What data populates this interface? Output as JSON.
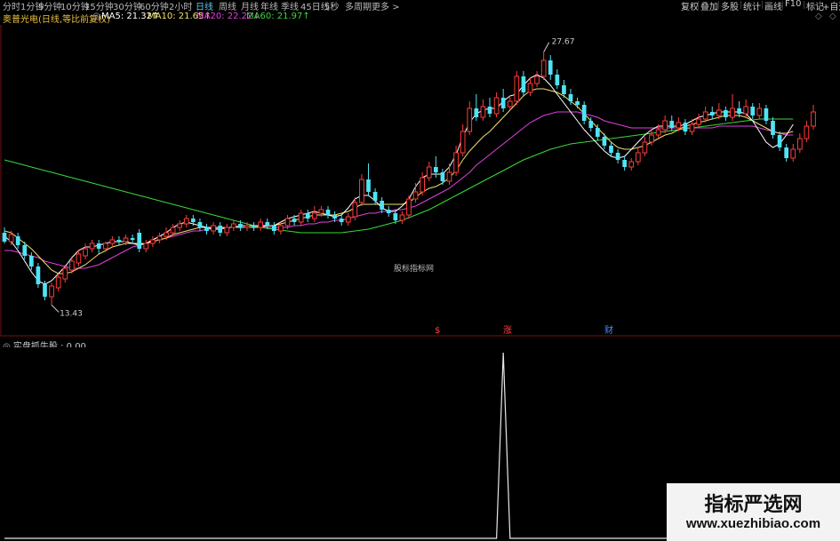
{
  "toolbar": {
    "periods": [
      "分时",
      "1分钟",
      "5分钟",
      "10分钟",
      "15分钟",
      "30分钟",
      "60分钟",
      "2小时",
      "日线",
      "周线",
      "月线",
      "年线",
      "季线",
      "45日线",
      "5秒",
      "多周期",
      "更多 >"
    ],
    "active_period": "日线",
    "right_buttons": [
      "复权",
      "叠加",
      "多股",
      "统计",
      "画线",
      "F10",
      "标记",
      "+自选"
    ]
  },
  "stock": {
    "title": "奥普光电(日线,等比前复权)",
    "ma": [
      {
        "label": "MA5: 21.32↑",
        "color": "#ffffff"
      },
      {
        "label": "MA10: 21.65↑",
        "color": "#f2e06a"
      },
      {
        "label": "MA20: 22.22↓",
        "color": "#e040e0"
      },
      {
        "label": "MA60: 21.97↑",
        "color": "#3ad83a"
      }
    ]
  },
  "chart_data": {
    "type": "candlestick",
    "high_label": "27.67",
    "low_label": "13.43",
    "center_label": "股标指标网",
    "event_markers": [
      {
        "text": "$",
        "color": "#ff4040"
      },
      {
        "text": "涨",
        "color": "#ff4040"
      },
      {
        "text": "财",
        "color": "#4a8cff"
      }
    ],
    "price_range": [
      12.5,
      28.5
    ],
    "candles": [
      [
        17.5,
        17.0,
        17.8,
        16.9
      ],
      [
        17.0,
        17.4,
        17.6,
        16.8
      ],
      [
        17.3,
        16.8,
        17.5,
        16.6
      ],
      [
        16.8,
        16.2,
        17.0,
        16.0
      ],
      [
        16.2,
        15.6,
        16.4,
        15.4
      ],
      [
        15.6,
        14.6,
        15.8,
        14.4
      ],
      [
        14.6,
        13.9,
        14.8,
        13.7
      ],
      [
        13.9,
        14.5,
        14.7,
        13.43
      ],
      [
        14.4,
        15.0,
        15.2,
        14.2
      ],
      [
        14.9,
        15.5,
        15.7,
        14.7
      ],
      [
        15.4,
        15.9,
        16.1,
        15.2
      ],
      [
        15.8,
        16.3,
        16.5,
        15.6
      ],
      [
        16.2,
        16.6,
        16.9,
        16.0
      ],
      [
        16.6,
        16.9,
        17.1,
        16.4
      ],
      [
        16.9,
        16.6,
        17.1,
        16.3
      ],
      [
        16.6,
        16.9,
        17.0,
        16.4
      ],
      [
        16.9,
        17.1,
        17.3,
        16.7
      ],
      [
        17.1,
        17.0,
        17.3,
        16.8
      ],
      [
        17.0,
        17.2,
        17.4,
        16.8
      ],
      [
        17.2,
        17.1,
        17.4,
        16.9
      ],
      [
        17.5,
        16.6,
        17.7,
        16.4
      ],
      [
        16.6,
        16.9,
        17.1,
        16.4
      ],
      [
        16.9,
        17.1,
        17.3,
        16.7
      ],
      [
        17.1,
        17.3,
        17.5,
        16.9
      ],
      [
        17.3,
        17.5,
        17.8,
        17.1
      ],
      [
        17.5,
        17.8,
        18.0,
        17.3
      ],
      [
        17.8,
        18.0,
        18.2,
        17.6
      ],
      [
        18.0,
        18.3,
        18.5,
        17.8
      ],
      [
        18.3,
        18.1,
        18.5,
        17.9
      ],
      [
        18.1,
        17.8,
        18.3,
        17.6
      ],
      [
        17.8,
        17.6,
        18.0,
        17.4
      ],
      [
        17.6,
        17.9,
        18.1,
        17.4
      ],
      [
        17.9,
        17.5,
        18.1,
        17.3
      ],
      [
        17.5,
        17.8,
        18.0,
        17.3
      ],
      [
        17.8,
        18.0,
        18.2,
        17.6
      ],
      [
        18.0,
        17.8,
        18.2,
        17.6
      ],
      [
        17.8,
        17.9,
        18.1,
        17.6
      ],
      [
        17.9,
        17.8,
        18.1,
        17.6
      ],
      [
        17.8,
        18.1,
        18.3,
        17.6
      ],
      [
        18.1,
        17.9,
        18.3,
        17.7
      ],
      [
        17.9,
        17.6,
        18.1,
        17.4
      ],
      [
        17.6,
        17.9,
        18.1,
        17.4
      ],
      [
        17.9,
        18.3,
        18.5,
        17.7
      ],
      [
        18.3,
        18.1,
        18.5,
        17.9
      ],
      [
        18.1,
        18.6,
        18.8,
        17.9
      ],
      [
        18.6,
        18.3,
        18.8,
        18.1
      ],
      [
        18.3,
        18.6,
        19.0,
        18.1
      ],
      [
        18.6,
        18.8,
        19.0,
        18.4
      ],
      [
        18.8,
        18.5,
        19.0,
        18.3
      ],
      [
        18.5,
        18.3,
        18.7,
        18.1
      ],
      [
        18.3,
        18.1,
        18.5,
        17.9
      ],
      [
        18.1,
        18.4,
        18.6,
        17.9
      ],
      [
        18.4,
        19.2,
        19.5,
        18.2
      ],
      [
        19.2,
        20.5,
        20.8,
        19.0
      ],
      [
        20.5,
        19.8,
        21.4,
        19.6
      ],
      [
        19.8,
        19.3,
        20.0,
        19.1
      ],
      [
        19.3,
        18.8,
        19.5,
        18.6
      ],
      [
        18.8,
        18.6,
        19.0,
        18.4
      ],
      [
        18.6,
        18.2,
        18.8,
        18.0
      ],
      [
        18.2,
        18.5,
        18.7,
        18.0
      ],
      [
        18.5,
        19.4,
        19.6,
        18.3
      ],
      [
        19.4,
        19.8,
        20.3,
        19.2
      ],
      [
        19.8,
        20.6,
        20.9,
        19.6
      ],
      [
        20.6,
        21.2,
        21.5,
        20.4
      ],
      [
        21.2,
        20.9,
        21.8,
        20.6
      ],
      [
        20.9,
        20.4,
        21.1,
        20.2
      ],
      [
        20.4,
        20.9,
        21.4,
        20.2
      ],
      [
        20.9,
        22.0,
        22.4,
        20.7
      ],
      [
        22.0,
        23.2,
        23.6,
        21.8
      ],
      [
        23.2,
        24.5,
        24.9,
        23.0
      ],
      [
        24.5,
        24.0,
        25.3,
        23.8
      ],
      [
        24.0,
        24.6,
        25.0,
        23.8
      ],
      [
        24.6,
        24.2,
        25.1,
        24.0
      ],
      [
        24.2,
        25.1,
        25.4,
        24.0
      ],
      [
        25.1,
        24.5,
        25.6,
        24.3
      ],
      [
        24.6,
        24.9,
        25.2,
        24.4
      ],
      [
        24.9,
        26.3,
        26.6,
        24.7
      ],
      [
        26.3,
        25.4,
        26.6,
        25.2
      ],
      [
        25.4,
        25.9,
        26.2,
        25.2
      ],
      [
        25.9,
        26.3,
        26.6,
        25.7
      ],
      [
        26.3,
        27.2,
        27.67,
        26.1
      ],
      [
        27.2,
        26.4,
        27.5,
        26.1
      ],
      [
        26.4,
        25.8,
        26.7,
        25.6
      ],
      [
        25.8,
        25.3,
        26.1,
        25.1
      ],
      [
        25.3,
        24.9,
        25.6,
        24.7
      ],
      [
        24.9,
        24.7,
        25.1,
        24.5
      ],
      [
        24.7,
        23.8,
        24.9,
        23.6
      ],
      [
        23.8,
        23.4,
        24.0,
        23.2
      ],
      [
        23.4,
        22.9,
        23.6,
        22.7
      ],
      [
        22.9,
        22.4,
        23.1,
        22.2
      ],
      [
        22.4,
        22.0,
        22.6,
        21.8
      ],
      [
        22.0,
        21.6,
        22.2,
        21.4
      ],
      [
        21.6,
        21.2,
        21.8,
        21.0
      ],
      [
        21.2,
        21.5,
        21.7,
        21.0
      ],
      [
        21.5,
        22.0,
        22.3,
        21.3
      ],
      [
        22.0,
        22.6,
        22.9,
        21.8
      ],
      [
        22.6,
        23.0,
        23.3,
        22.4
      ],
      [
        23.0,
        23.3,
        23.6,
        22.8
      ],
      [
        23.3,
        23.8,
        24.1,
        23.1
      ],
      [
        23.8,
        23.4,
        24.1,
        23.2
      ],
      [
        23.4,
        23.7,
        24.0,
        23.2
      ],
      [
        23.7,
        23.2,
        23.9,
        23.0
      ],
      [
        23.2,
        23.6,
        23.9,
        23.0
      ],
      [
        23.6,
        23.9,
        24.2,
        23.4
      ],
      [
        23.9,
        24.3,
        24.6,
        23.7
      ],
      [
        24.3,
        24.1,
        24.6,
        23.9
      ],
      [
        24.1,
        24.4,
        24.8,
        23.9
      ],
      [
        24.4,
        24.0,
        24.6,
        23.8
      ],
      [
        24.0,
        24.5,
        25.3,
        23.8
      ],
      [
        24.5,
        24.2,
        24.9,
        24.0
      ],
      [
        24.2,
        24.6,
        25.0,
        24.0
      ],
      [
        24.6,
        24.1,
        24.8,
        23.9
      ],
      [
        24.1,
        24.5,
        24.8,
        23.9
      ],
      [
        24.5,
        23.8,
        24.7,
        23.6
      ],
      [
        23.8,
        23.0,
        24.0,
        22.8
      ],
      [
        23.0,
        22.3,
        23.2,
        22.1
      ],
      [
        22.3,
        21.7,
        22.5,
        21.5
      ],
      [
        21.7,
        22.2,
        22.5,
        21.5
      ],
      [
        22.2,
        22.8,
        23.1,
        22.0
      ],
      [
        22.8,
        23.5,
        23.8,
        22.6
      ],
      [
        23.5,
        24.3,
        24.7,
        23.3
      ]
    ],
    "ma5": [
      17.3,
      17.0,
      16.5,
      15.9,
      15.3,
      14.8,
      14.6,
      14.8,
      15.2,
      15.6,
      16.1,
      16.5,
      16.7,
      16.7,
      16.8,
      16.9,
      17.0,
      17.0,
      17.0,
      16.9,
      16.8,
      16.9,
      17.1,
      17.3,
      17.5,
      17.8,
      18.0,
      18.1,
      18.0,
      17.9,
      17.8,
      17.7,
      17.7,
      17.8,
      17.8,
      17.9,
      17.9,
      17.9,
      17.9,
      17.9,
      17.9,
      18.1,
      18.3,
      18.4,
      18.5,
      18.6,
      18.7,
      18.6,
      18.5,
      18.4,
      18.5,
      18.9,
      19.4,
      19.6,
      19.6,
      19.3,
      18.9,
      18.7,
      18.7,
      19.0,
      19.4,
      20.1,
      20.6,
      20.8,
      20.8,
      20.8,
      21.2,
      21.9,
      22.9,
      23.7,
      24.2,
      24.4,
      24.5,
      24.5,
      24.9,
      25.2,
      25.3,
      25.8,
      26.2,
      26.4,
      26.2,
      25.8,
      25.3,
      24.8,
      24.3,
      23.8,
      23.3,
      22.9,
      22.5,
      22.1,
      21.8,
      21.7,
      21.8,
      22.2,
      22.6,
      23.0,
      23.3,
      23.5,
      23.5,
      23.5,
      23.5,
      23.6,
      23.8,
      24.0,
      24.1,
      24.2,
      24.3,
      24.3,
      24.3,
      24.3,
      24.2,
      23.8,
      23.2,
      22.6,
      22.3,
      22.5,
      23.0,
      23.6
    ],
    "ma10": [
      17.6,
      17.5,
      17.2,
      16.9,
      16.6,
      16.2,
      15.8,
      15.4,
      15.2,
      15.2,
      15.3,
      15.5,
      15.7,
      16.0,
      16.3,
      16.5,
      16.7,
      16.8,
      16.9,
      16.9,
      16.9,
      16.9,
      17.0,
      17.1,
      17.2,
      17.4,
      17.5,
      17.6,
      17.7,
      17.8,
      17.8,
      17.8,
      17.8,
      17.8,
      17.8,
      17.8,
      17.8,
      17.8,
      17.8,
      17.9,
      17.9,
      18.0,
      18.1,
      18.2,
      18.3,
      18.4,
      18.5,
      18.5,
      18.5,
      18.5,
      18.6,
      18.7,
      18.9,
      19.1,
      19.1,
      19.1,
      19.1,
      19.1,
      19.1,
      19.1,
      19.2,
      19.5,
      19.8,
      20.0,
      20.1,
      20.3,
      20.6,
      21.0,
      21.6,
      22.1,
      22.5,
      22.9,
      23.2,
      23.6,
      24.0,
      24.4,
      24.8,
      25.2,
      25.5,
      25.6,
      25.6,
      25.5,
      25.4,
      25.2,
      24.9,
      24.6,
      24.2,
      23.8,
      23.4,
      23.0,
      22.6,
      22.3,
      22.2,
      22.2,
      22.3,
      22.4,
      22.6,
      22.8,
      23.0,
      23.1,
      23.3,
      23.5,
      23.6,
      23.7,
      23.8,
      23.9,
      24.0,
      24.1,
      24.1,
      24.1,
      24.0,
      23.8,
      23.6,
      23.4,
      23.2,
      23.1,
      23.1,
      23.2
    ],
    "ma20": [
      16.5,
      16.5,
      16.4,
      16.3,
      16.2,
      16.1,
      15.9,
      15.8,
      15.7,
      15.6,
      15.5,
      15.5,
      15.5,
      15.6,
      15.7,
      15.9,
      16.1,
      16.3,
      16.5,
      16.7,
      16.8,
      16.9,
      17.0,
      17.1,
      17.2,
      17.3,
      17.4,
      17.5,
      17.6,
      17.6,
      17.7,
      17.7,
      17.8,
      17.8,
      17.8,
      17.8,
      17.8,
      17.8,
      17.8,
      17.8,
      17.8,
      17.8,
      17.8,
      17.9,
      17.9,
      18.0,
      18.0,
      18.1,
      18.1,
      18.2,
      18.2,
      18.3,
      18.4,
      18.5,
      18.6,
      18.6,
      18.7,
      18.7,
      18.8,
      18.8,
      18.9,
      19.0,
      19.2,
      19.4,
      19.6,
      19.8,
      20.0,
      20.3,
      20.6,
      20.9,
      21.3,
      21.6,
      21.9,
      22.2,
      22.5,
      22.8,
      23.1,
      23.4,
      23.7,
      23.9,
      24.1,
      24.2,
      24.3,
      24.3,
      24.3,
      24.3,
      24.2,
      24.1,
      24.0,
      23.8,
      23.7,
      23.6,
      23.5,
      23.4,
      23.4,
      23.4,
      23.4,
      23.4,
      23.4,
      23.4,
      23.4,
      23.4,
      23.4,
      23.4,
      23.4,
      23.4,
      23.5,
      23.5,
      23.5,
      23.5,
      23.5,
      23.5,
      23.4,
      23.3,
      23.2,
      23.1,
      23.0,
      23.0
    ],
    "ma60": [
      21.6,
      21.5,
      21.4,
      21.3,
      21.2,
      21.1,
      21.0,
      20.9,
      20.8,
      20.7,
      20.6,
      20.5,
      20.4,
      20.3,
      20.2,
      20.1,
      20.0,
      19.9,
      19.8,
      19.7,
      19.6,
      19.5,
      19.4,
      19.3,
      19.2,
      19.1,
      19.0,
      18.9,
      18.8,
      18.7,
      18.6,
      18.5,
      18.4,
      18.3,
      18.2,
      18.1,
      18.0,
      17.9,
      17.8,
      17.75,
      17.7,
      17.65,
      17.6,
      17.55,
      17.5,
      17.5,
      17.5,
      17.5,
      17.5,
      17.5,
      17.5,
      17.55,
      17.6,
      17.65,
      17.7,
      17.8,
      17.9,
      18.0,
      18.1,
      18.2,
      18.35,
      18.5,
      18.65,
      18.8,
      19.0,
      19.2,
      19.4,
      19.6,
      19.8,
      20.0,
      20.2,
      20.4,
      20.6,
      20.8,
      21.0,
      21.2,
      21.4,
      21.6,
      21.75,
      21.9,
      22.05,
      22.2,
      22.3,
      22.4,
      22.5,
      22.55,
      22.6,
      22.65,
      22.7,
      22.75,
      22.8,
      22.85,
      22.9,
      22.95,
      23.0,
      23.05,
      23.1,
      23.15,
      23.2,
      23.25,
      23.3,
      23.35,
      23.4,
      23.45,
      23.5,
      23.55,
      23.6,
      23.65,
      23.7,
      23.75,
      23.8,
      23.85,
      23.9,
      23.9,
      23.9,
      23.9,
      23.9,
      23.9
    ],
    "indicator": {
      "name": "实盘抓牛股",
      "value_label": ": 0.00",
      "values": [
        0,
        0,
        0,
        0,
        0,
        0,
        0,
        0,
        0,
        0,
        0,
        0,
        0,
        0,
        0,
        0,
        0,
        0,
        0,
        0,
        0,
        0,
        0,
        0,
        0,
        0,
        0,
        0,
        0,
        0,
        0,
        0,
        0,
        0,
        0,
        0,
        0,
        0,
        0,
        0,
        0,
        0,
        0,
        0,
        0,
        0,
        0,
        0,
        0,
        0,
        0,
        0,
        0,
        0,
        0,
        0,
        0,
        0,
        0,
        0,
        0,
        0,
        0,
        0,
        0,
        0,
        0,
        0,
        0,
        0,
        0,
        0,
        0,
        0,
        1,
        0,
        0,
        0,
        0,
        0,
        0,
        0,
        0,
        0,
        0,
        0,
        0,
        0,
        0,
        0,
        0,
        0,
        0,
        0,
        0,
        0,
        0,
        0,
        0,
        0,
        0,
        0,
        0,
        0,
        0,
        0,
        0,
        0,
        0,
        0,
        0,
        0,
        0,
        0,
        0,
        0,
        0,
        0,
        0,
        0
      ],
      "range": [
        0,
        1
      ]
    }
  },
  "watermark": {
    "cn": "指标严选网",
    "url": "www.xuezhibiao.com"
  },
  "colors": {
    "up": "#ff3b3b",
    "down": "#4fe3f5",
    "ma5": "#ffffff",
    "ma10": "#f2e06a",
    "ma20": "#e040e0",
    "ma60": "#3ad83a",
    "active_period": "#5cc8f0"
  }
}
